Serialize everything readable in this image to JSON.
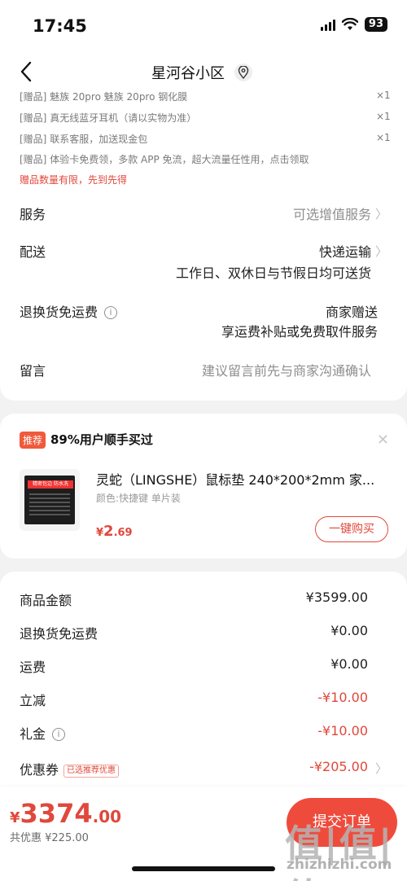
{
  "status_bar": {
    "time": "17:45",
    "battery": "93"
  },
  "nav": {
    "title": "星河谷小区"
  },
  "gifts": [
    {
      "tag": "[赠品]",
      "text": "魅族 20pro 魅族 20pro 钢化膜",
      "qty": "×1"
    },
    {
      "tag": "[赠品]",
      "text": "真无线蓝牙耳机（请以实物为准）",
      "qty": "×1"
    },
    {
      "tag": "[赠品]",
      "text": "联系客服，加送现金包",
      "qty": "×1"
    },
    {
      "tag": "[赠品]",
      "text": "体验卡免费领，多款 APP 免流，超大流量任性用，点击领取",
      "qty": ""
    }
  ],
  "gift_notice": "赠品数量有限，先到先得",
  "order_rows": {
    "service": {
      "label": "服务",
      "value": "可选增值服务"
    },
    "delivery": {
      "label": "配送",
      "value": "快递运输",
      "sub": "工作日、双休日与节假日均可送货"
    },
    "return_shipping": {
      "label": "退换货免运费",
      "value": "商家赠送",
      "sub": "享运费补贴或免费取件服务"
    },
    "message": {
      "label": "留言",
      "placeholder": "建议留言前先与商家沟通确认"
    }
  },
  "recommend": {
    "tag": "推荐",
    "text": "89%用户顺手买过",
    "product": {
      "title": "灵蛇（LINGSHE）鼠标垫 240*200*2mm 家...",
      "attrs": "颜色:快捷键  单片装",
      "price_symbol": "¥",
      "price_int": "2",
      "price_dec": ".69",
      "image_banner": "精密包边 防水洗"
    },
    "buy_label": "一键购买"
  },
  "summary": [
    {
      "label": "商品金额",
      "value": "¥3599.00",
      "red": false
    },
    {
      "label": "退换货免运费",
      "value": "¥0.00",
      "red": false
    },
    {
      "label": "运费",
      "value": "¥0.00",
      "red": false
    },
    {
      "label": "立减",
      "value": "-¥10.00",
      "red": true
    },
    {
      "label": "礼金",
      "value": "-¥10.00",
      "red": true
    },
    {
      "label": "优惠券",
      "value": "-¥205.00",
      "red": true,
      "tag": "已选推荐优惠"
    }
  ],
  "bottom": {
    "price_symbol": "¥",
    "price_int": "3374",
    "price_dec": ".00",
    "discount_text": "共优惠 ¥225.00",
    "submit_label": "提交订单"
  },
  "watermark": {
    "main": "值|值|值",
    "url": "zhizhizhi.com"
  },
  "colors": {
    "accent": "#e0483b",
    "button": "#ef4b3c"
  }
}
